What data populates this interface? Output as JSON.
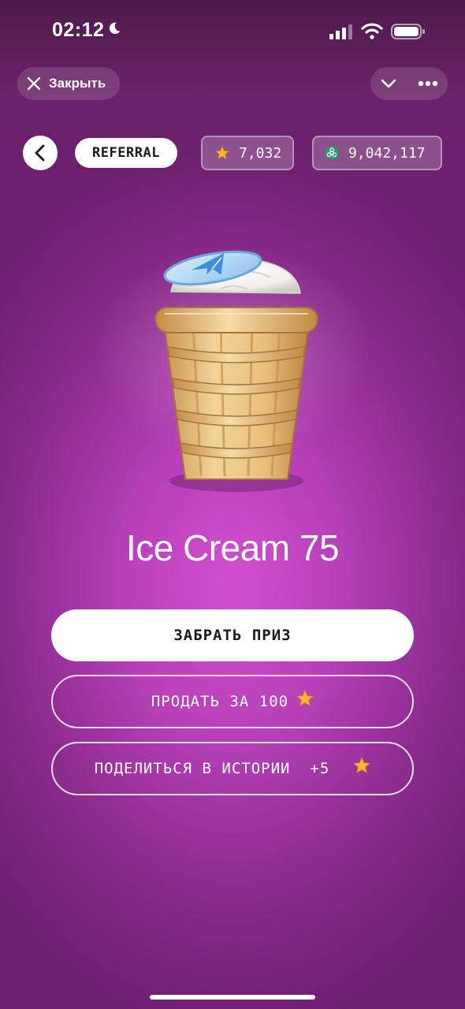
{
  "status_bar": {
    "time": "02:12"
  },
  "top_bar": {
    "close_label": "Закрыть"
  },
  "header": {
    "referral_label": "REFERRAL",
    "stars_balance": "7,032",
    "coins_balance": "9,042,117"
  },
  "prize": {
    "title": "Ice Cream 75"
  },
  "actions": {
    "claim_label": "ЗАБРАТЬ ПРИЗ",
    "sell_label": "ПРОДАТЬ ЗА 100",
    "share_label": "ПОДЕЛИТЬСЯ В ИСТОРИИ  +5"
  },
  "colors": {
    "background_center": "#d44fd0",
    "background_edge": "#6c2071",
    "star": "#f5b82e",
    "coin": "#1fa36a"
  },
  "icons": [
    "moon-icon",
    "signal-icon",
    "wifi-icon",
    "battery-icon",
    "close-icon",
    "chevron-down-icon",
    "more-icon",
    "back-arrow-icon",
    "star-icon",
    "biohazard-coin-icon",
    "ice-cream-illustration"
  ]
}
